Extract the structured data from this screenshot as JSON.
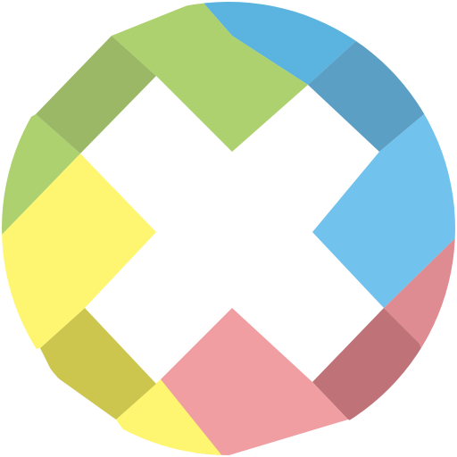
{
  "logo": {
    "icon": "multicolor-x-circle-logo",
    "colors": {
      "green": "#AED16F",
      "green_dark": "#9BB866",
      "blue_top": "#5AB4DF",
      "blue_top_dark": "#5B9FC4",
      "blue": "#72C2EE",
      "pink_light": "#DF8B92",
      "pink_dark": "#BF7378",
      "pink": "#F09EA1",
      "yellow": "#FEF671",
      "yellow_dark": "#CCC64F",
      "background": "#FFFFFF"
    }
  }
}
